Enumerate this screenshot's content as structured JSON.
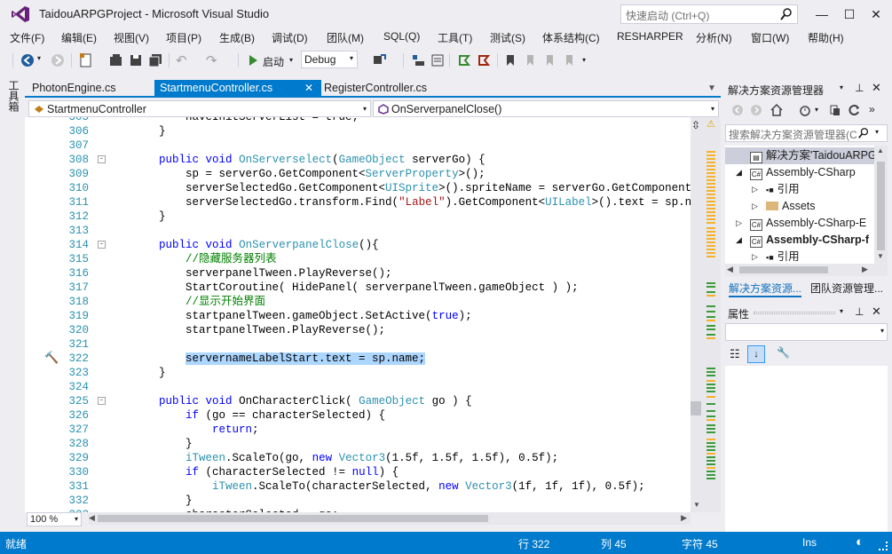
{
  "window": {
    "title": "TaidouARPGProject - Microsoft Visual Studio",
    "quick_launch_placeholder": "快速启动 (Ctrl+Q)"
  },
  "menu": [
    "文件(F)",
    "编辑(E)",
    "视图(V)",
    "项目(P)",
    "生成(B)",
    "调试(D)",
    "团队(M)",
    "SQL(Q)",
    "工具(T)",
    "测试(S)",
    "体系结构(C)",
    "RESHARPER",
    "分析(N)",
    "窗口(W)",
    "帮助(H)"
  ],
  "toolbar": {
    "start_label": "启动",
    "configuration": "Debug"
  },
  "toolbox_label": "工具箱",
  "tabs": [
    {
      "label": "PhotonEngine.cs",
      "active": false
    },
    {
      "label": "StartmenuController.cs",
      "active": true
    },
    {
      "label": "RegisterController.cs",
      "active": false
    }
  ],
  "nav": {
    "type_dropdown": "StartmenuController",
    "member_dropdown": "OnServerpanelClose()"
  },
  "editor": {
    "zoom": "100 %",
    "highlighted_line": 322,
    "lines": [
      {
        "n": "305",
        "fold": "",
        "html": "        <span>haveInitServerList = true;</span>"
      },
      {
        "n": "306",
        "fold": "",
        "html": "    }"
      },
      {
        "n": "307",
        "fold": "",
        "html": ""
      },
      {
        "n": "308",
        "fold": "-",
        "html": "    <span class='kw'>public</span> <span class='kw'>void</span> <span class='ty'>OnServerselect</span>(<span class='ty'>GameObject</span> serverGo) {"
      },
      {
        "n": "309",
        "fold": "",
        "html": "        sp = serverGo.GetComponent&lt;<span class='ty'>ServerProperty</span>&gt;();"
      },
      {
        "n": "310",
        "fold": "",
        "html": "        serverSelectedGo.GetComponent&lt;<span class='ty'>UISprite</span>&gt;().spriteName = serverGo.GetComponent&lt;<span class='ty'>UISprite</span>&gt;"
      },
      {
        "n": "311",
        "fold": "",
        "html": "        serverSelectedGo.transform.Find(<span class='str'>\"Label\"</span>).GetComponent&lt;<span class='ty'>UILabel</span>&gt;().text = sp.name;"
      },
      {
        "n": "312",
        "fold": "",
        "html": "    }"
      },
      {
        "n": "313",
        "fold": "",
        "html": ""
      },
      {
        "n": "314",
        "fold": "-",
        "html": "    <span class='kw'>public</span> <span class='kw'>void</span> <span class='ty'>OnServerpanelClose</span>(){"
      },
      {
        "n": "315",
        "fold": "",
        "html": "        <span class='cm'>//隐藏服务器列表</span>"
      },
      {
        "n": "316",
        "fold": "",
        "html": "        serverpanelTween.PlayReverse();"
      },
      {
        "n": "317",
        "fold": "",
        "html": "        StartCoroutine( HidePanel( serverpanelTween.gameObject ) );"
      },
      {
        "n": "318",
        "fold": "",
        "html": "        <span class='cm'>//显示开始界面</span>"
      },
      {
        "n": "319",
        "fold": "",
        "html": "        startpanelTween.gameObject.SetActive(<span class='kw'>true</span>);"
      },
      {
        "n": "320",
        "fold": "",
        "html": "        startpanelTween.PlayReverse();"
      },
      {
        "n": "321",
        "fold": "",
        "html": ""
      },
      {
        "n": "322",
        "fold": "",
        "html": "        <span class='sel'>servernameLabelStart.text = sp.name;</span>"
      },
      {
        "n": "323",
        "fold": "",
        "html": "    }"
      },
      {
        "n": "324",
        "fold": "",
        "html": ""
      },
      {
        "n": "325",
        "fold": "-",
        "html": "    <span class='kw'>public</span> <span class='kw'>void</span> OnCharacterClick( <span class='ty'>GameObject</span> go ) {"
      },
      {
        "n": "326",
        "fold": "",
        "html": "        <span class='kw'>if</span> (go == characterSelected) {"
      },
      {
        "n": "327",
        "fold": "",
        "html": "            <span class='kw'>return</span>;"
      },
      {
        "n": "328",
        "fold": "",
        "html": "        }"
      },
      {
        "n": "329",
        "fold": "",
        "html": "        <span class='ty'>iTween</span>.ScaleTo(go, <span class='kw'>new</span> <span class='ty'>Vector3</span>(1.5f, 1.5f, 1.5f), 0.5f);"
      },
      {
        "n": "330",
        "fold": "",
        "html": "        <span class='kw'>if</span> (characterSelected != <span class='kw'>null</span>) {"
      },
      {
        "n": "331",
        "fold": "",
        "html": "            <span class='ty'>iTween</span>.ScaleTo(characterSelected, <span class='kw'>new</span> <span class='ty'>Vector3</span>(1f, 1f, 1f), 0.5f);"
      },
      {
        "n": "332",
        "fold": "",
        "html": "        }"
      },
      {
        "n": "333",
        "fold": "",
        "html": "        characterSelected = go;"
      }
    ]
  },
  "solution_explorer": {
    "title": "解决方案资源管理器",
    "search_placeholder": "搜索解决方案资源管理器(C",
    "items": [
      {
        "label": "解决方案'TaidouARPGPr",
        "kind": "solution",
        "arrow": "",
        "bold": false
      },
      {
        "label": "Assembly-CSharp",
        "kind": "cs",
        "arrow": "◢",
        "bold": false
      },
      {
        "label": "引用",
        "kind": "ref",
        "arrow": "▷",
        "bold": false
      },
      {
        "label": "Assets",
        "kind": "folder",
        "arrow": "▷",
        "bold": false
      },
      {
        "label": "Assembly-CSharp-E",
        "kind": "cs",
        "arrow": "▷",
        "bold": false
      },
      {
        "label": "Assembly-CSharp-f",
        "kind": "cs",
        "arrow": "◢",
        "bold": true
      },
      {
        "label": "引用",
        "kind": "ref",
        "arrow": "▷",
        "bold": false
      }
    ],
    "tab_solution": "解决方案资源...",
    "tab_team": "团队资源管理..."
  },
  "properties": {
    "title": "属性"
  },
  "status": {
    "ready": "就绪",
    "line": "行 322",
    "col": "列 45",
    "char": "字符 45",
    "mode": "Ins"
  },
  "colors": {
    "accent": "#007acc",
    "keyword": "#0000ff",
    "type": "#2b91af",
    "comment": "#008000",
    "string": "#a31515",
    "selection": "#add6ff"
  }
}
